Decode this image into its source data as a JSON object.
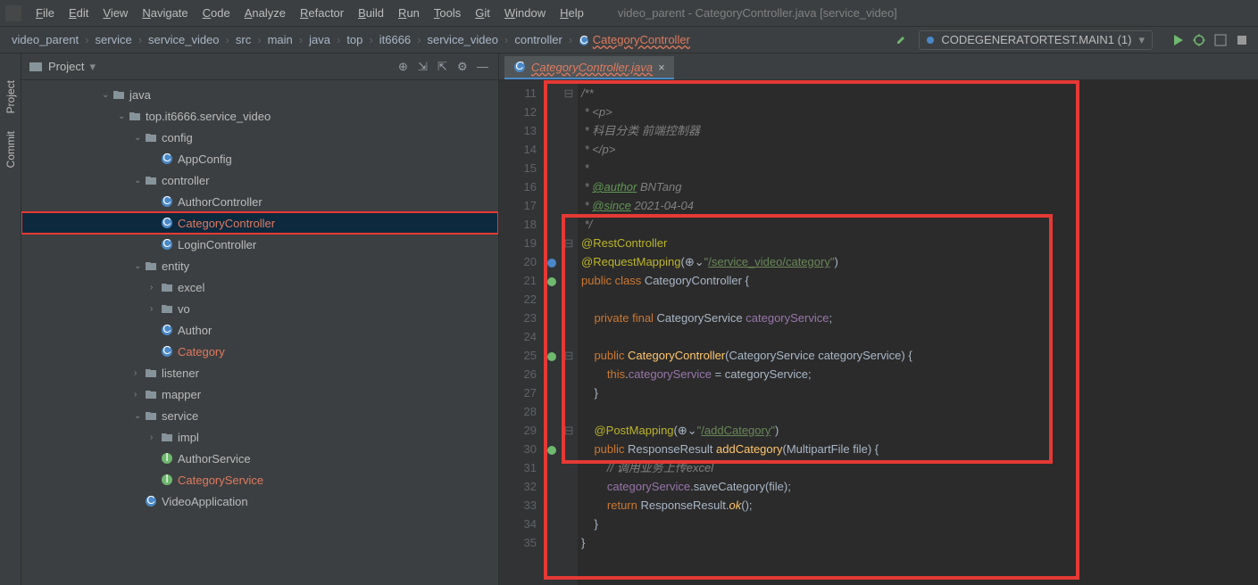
{
  "window": {
    "title": "video_parent - CategoryController.java [service_video]"
  },
  "menu": [
    "File",
    "Edit",
    "View",
    "Navigate",
    "Code",
    "Analyze",
    "Refactor",
    "Build",
    "Run",
    "Tools",
    "Git",
    "Window",
    "Help"
  ],
  "breadcrumbs": [
    "video_parent",
    "service",
    "service_video",
    "src",
    "main",
    "java",
    "top",
    "it6666",
    "service_video",
    "controller",
    "CategoryController"
  ],
  "run_config": {
    "label": "CODEGENERATORTEST.MAIN1 (1)"
  },
  "toolstrip": {
    "project": "Project",
    "commit": "Commit"
  },
  "sidebar": {
    "title": "Project"
  },
  "tree": [
    {
      "depth": 5,
      "chev": "v",
      "icon": "folder",
      "label": "java"
    },
    {
      "depth": 6,
      "chev": "v",
      "icon": "folder",
      "label": "top.it6666.service_video"
    },
    {
      "depth": 7,
      "chev": "v",
      "icon": "folder",
      "label": "config"
    },
    {
      "depth": 8,
      "chev": "",
      "icon": "class",
      "label": "AppConfig"
    },
    {
      "depth": 7,
      "chev": "v",
      "icon": "folder",
      "label": "controller"
    },
    {
      "depth": 8,
      "chev": "",
      "icon": "class",
      "label": "AuthorController"
    },
    {
      "depth": 8,
      "chev": "",
      "icon": "class",
      "label": "CategoryController",
      "selected": true,
      "orange": true
    },
    {
      "depth": 8,
      "chev": "",
      "icon": "class",
      "label": "LoginController"
    },
    {
      "depth": 7,
      "chev": "v",
      "icon": "folder",
      "label": "entity"
    },
    {
      "depth": 8,
      "chev": ">",
      "icon": "folder",
      "label": "excel"
    },
    {
      "depth": 8,
      "chev": ">",
      "icon": "folder",
      "label": "vo"
    },
    {
      "depth": 8,
      "chev": "",
      "icon": "class",
      "label": "Author"
    },
    {
      "depth": 8,
      "chev": "",
      "icon": "class",
      "label": "Category",
      "orange": true
    },
    {
      "depth": 7,
      "chev": ">",
      "icon": "folder",
      "label": "listener"
    },
    {
      "depth": 7,
      "chev": ">",
      "icon": "folder",
      "label": "mapper"
    },
    {
      "depth": 7,
      "chev": "v",
      "icon": "folder",
      "label": "service"
    },
    {
      "depth": 8,
      "chev": ">",
      "icon": "folder",
      "label": "impl"
    },
    {
      "depth": 8,
      "chev": "",
      "icon": "interface",
      "label": "AuthorService"
    },
    {
      "depth": 8,
      "chev": "",
      "icon": "interface",
      "label": "CategoryService",
      "orange": true
    },
    {
      "depth": 7,
      "chev": "",
      "icon": "class",
      "label": "VideoApplication"
    }
  ],
  "editor_tab": {
    "name": "CategoryController.java"
  },
  "gutter_start": 11,
  "gutter_end": 35,
  "code_lines": [
    {
      "n": 11,
      "fold": "⊟",
      "html": "<span class='c-comment'>/**</span>"
    },
    {
      "n": 12,
      "html": "<span class='c-comment'> * &lt;p&gt;</span>"
    },
    {
      "n": 13,
      "html": "<span class='c-comment'> * 科目分类 前端控制器</span>"
    },
    {
      "n": 14,
      "html": "<span class='c-comment'> * &lt;/p&gt;</span>"
    },
    {
      "n": 15,
      "html": "<span class='c-comment'> *</span>"
    },
    {
      "n": 16,
      "html": "<span class='c-comment'> * </span><span class='c-doctag'>@author</span><span class='c-comment'> BNTang</span>"
    },
    {
      "n": 17,
      "html": "<span class='c-comment'> * </span><span class='c-doctag'>@since</span><span class='c-comment'> 2021-04-04</span>"
    },
    {
      "n": 18,
      "html": "<span class='c-comment'> */</span>"
    },
    {
      "n": 19,
      "fold": "⊟",
      "html": "<span class='c-anno'>@RestController</span>"
    },
    {
      "n": 20,
      "gi": "url",
      "html": "<span class='c-anno'>@RequestMapping</span>(<span class='c-param'>⊕&#x2304;</span><span class='c-string'>\"</span><span class='c-string-u'>/service_video/category</span><span class='c-string'>\"</span>)"
    },
    {
      "n": 21,
      "gi": "bean",
      "html": "<span class='c-keyword'>public class </span><span class='c-class'>CategoryController</span> {"
    },
    {
      "n": 22,
      "html": ""
    },
    {
      "n": 23,
      "html": "    <span class='c-keyword'>private final </span><span class='c-class'>CategoryService </span><span class='c-field'>categoryService</span>;"
    },
    {
      "n": 24,
      "html": ""
    },
    {
      "n": 25,
      "gi": "bean",
      "fold": "⊟",
      "html": "    <span class='c-keyword'>public </span><span class='c-method'>CategoryController</span>(<span class='c-class'>CategoryService</span> categoryService) {"
    },
    {
      "n": 26,
      "html": "        <span class='c-keyword'>this</span>.<span class='c-field'>categoryService</span> = categoryService;"
    },
    {
      "n": 27,
      "html": "    }"
    },
    {
      "n": 28,
      "html": "    "
    },
    {
      "n": 29,
      "fold": "⊟",
      "html": "    <span class='c-anno'>@PostMapping</span>(<span class='c-param'>⊕&#x2304;</span><span class='c-string'>\"</span><span class='c-string-u'>/addCategory</span><span class='c-string'>\"</span>)"
    },
    {
      "n": 30,
      "gi": "bean",
      "html": "    <span class='c-keyword'>public </span><span class='c-class'>ResponseResult </span><span class='c-method'>addCategory</span>(<span class='c-class'>MultipartFile</span> file) {"
    },
    {
      "n": 31,
      "html": "        <span class='c-comment'>// 调用业务上传excel</span>"
    },
    {
      "n": 32,
      "html": "        <span class='c-field'>categoryService</span>.saveCategory(file);"
    },
    {
      "n": 33,
      "html": "        <span class='c-keyword'>return </span><span class='c-class'>ResponseResult</span>.<span class='c-method' style='font-style:italic'>ok</span>();"
    },
    {
      "n": 34,
      "html": "    }"
    },
    {
      "n": 35,
      "html": "}"
    }
  ]
}
